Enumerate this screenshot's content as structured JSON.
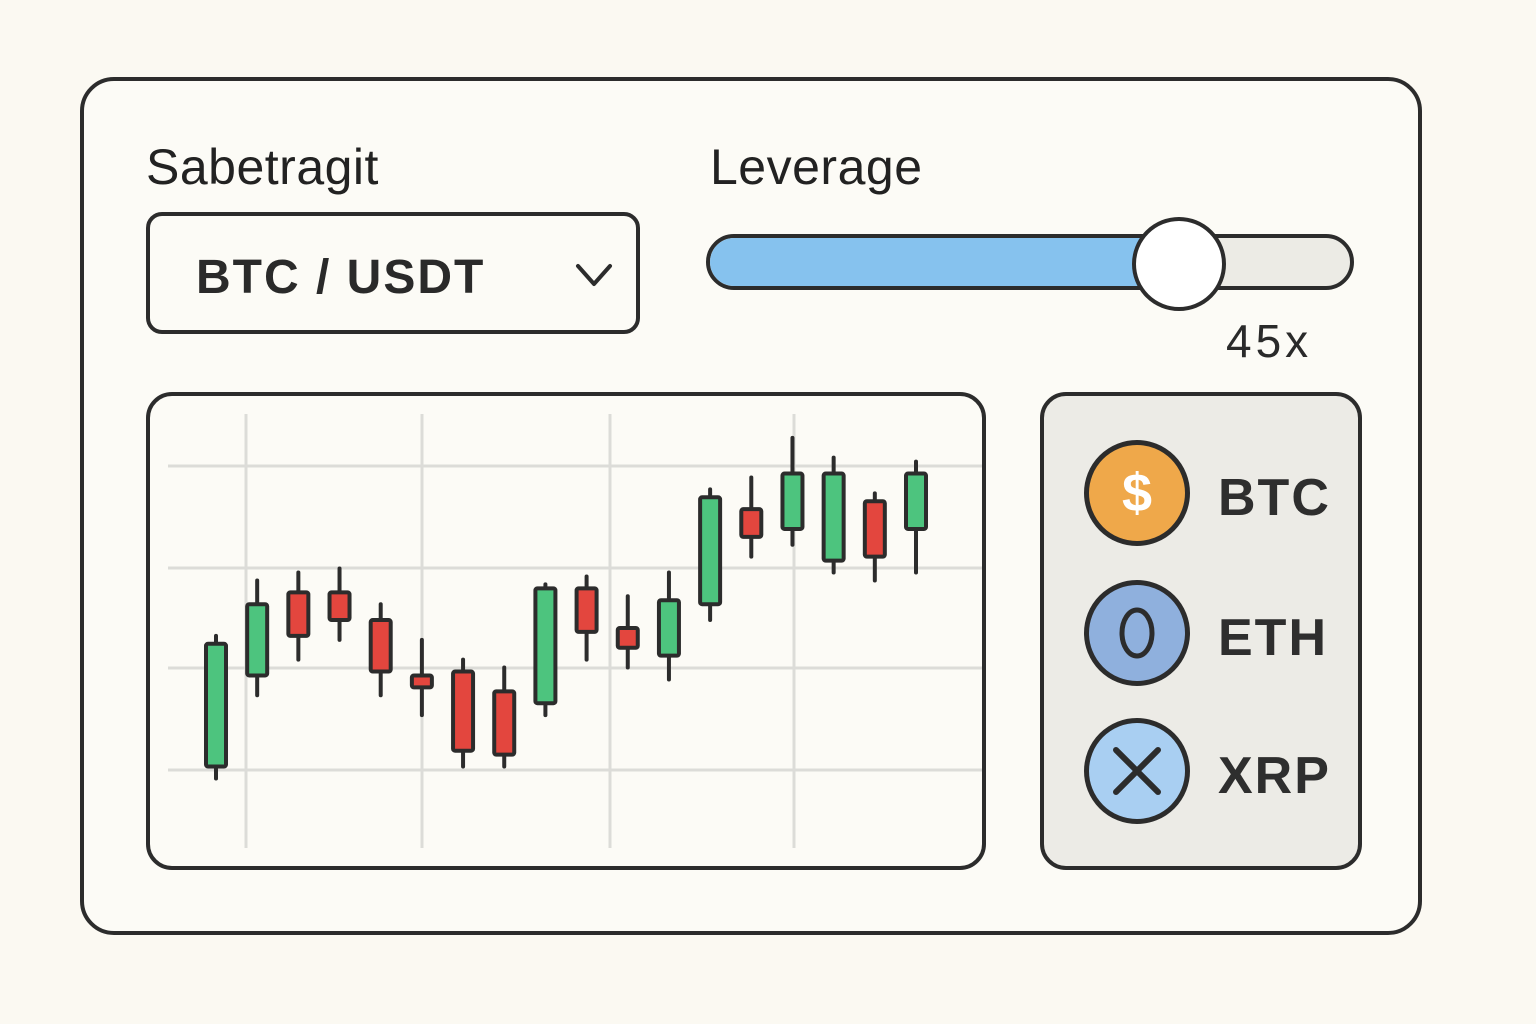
{
  "pair_selector": {
    "label": "Sabetragit",
    "value": "BTC / USDT",
    "icon": "chevron-down-icon"
  },
  "leverage": {
    "label": "Leverage",
    "value_text": "45x",
    "fill_fraction": 0.73,
    "fill_color": "#86c2ee"
  },
  "assets": [
    {
      "label": "BTC",
      "icon": "dollar-coin-icon",
      "color": "#efa84a"
    },
    {
      "label": "ETH",
      "icon": "eth-coin-icon",
      "color": "#8fb0dd"
    },
    {
      "label": "XRP",
      "icon": "xrp-x-icon",
      "color": "#a9cff2"
    }
  ],
  "colors": {
    "up": "#4dc47e",
    "down": "#e3463e",
    "outline": "#2c2c2c",
    "grid": "#dcdcd8"
  },
  "chart_data": {
    "type": "candlestick",
    "title": "",
    "xlabel": "",
    "ylabel": "",
    "ylim": [
      0,
      100
    ],
    "grid": true,
    "candles": [
      {
        "open": 14,
        "close": 45,
        "high": 47,
        "low": 11
      },
      {
        "open": 37,
        "close": 55,
        "high": 61,
        "low": 32
      },
      {
        "open": 58,
        "close": 47,
        "high": 63,
        "low": 41
      },
      {
        "open": 58,
        "close": 51,
        "high": 64,
        "low": 46
      },
      {
        "open": 51,
        "close": 38,
        "high": 55,
        "low": 32
      },
      {
        "open": 37,
        "close": 34,
        "high": 46,
        "low": 27
      },
      {
        "open": 38,
        "close": 18,
        "high": 41,
        "low": 14
      },
      {
        "open": 33,
        "close": 17,
        "high": 39,
        "low": 14
      },
      {
        "open": 30,
        "close": 59,
        "high": 60,
        "low": 27
      },
      {
        "open": 59,
        "close": 48,
        "high": 62,
        "low": 41
      },
      {
        "open": 49,
        "close": 44,
        "high": 57,
        "low": 39
      },
      {
        "open": 42,
        "close": 56,
        "high": 63,
        "low": 36
      },
      {
        "open": 55,
        "close": 82,
        "high": 84,
        "low": 51
      },
      {
        "open": 79,
        "close": 72,
        "high": 87,
        "low": 67
      },
      {
        "open": 74,
        "close": 88,
        "high": 97,
        "low": 70
      },
      {
        "open": 66,
        "close": 88,
        "high": 92,
        "low": 63
      },
      {
        "open": 81,
        "close": 67,
        "high": 83,
        "low": 61
      },
      {
        "open": 74,
        "close": 88,
        "high": 91,
        "low": 63
      }
    ]
  }
}
